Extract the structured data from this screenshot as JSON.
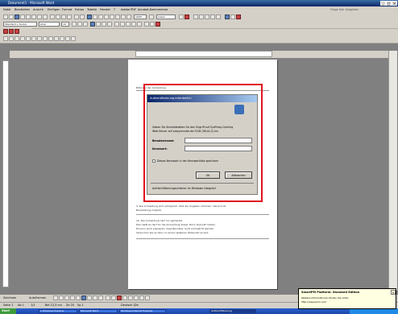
{
  "window": {
    "title": "Dokument1 - Microsoft Word"
  },
  "menu": [
    "Datei",
    "Bearbeiten",
    "Ansicht",
    "Einfügen",
    "Format",
    "Extras",
    "Tabelle",
    "Fenster",
    "?",
    "Adobe PDF",
    "Acrobat-Kommentare"
  ],
  "menu_hint": "Frage hier eingeben",
  "toolbar": {
    "style": "Standard + Kursiv",
    "font": "Arial",
    "size": "10",
    "zoom": "100%",
    "reading": "Lesen"
  },
  "page_lines": {
    "top": "Bitte bei der Anmeldung",
    "note1": "4. Die Anmeldung wird erfolgreich, falls die Angaben stimmen. Danach ist",
    "note2": "Bearbeitung möglich.",
    "p3_1": "10. Die Anmeldung darf nur gemeldet",
    "p3_2": "Das heißt es darf für die Anmeldung dieser Teil in Zukunft nutzen.",
    "p3_3": "Es kann auch passieren, dass Benutzer nicht ermöglicht werden.",
    "p3_4": "Versuchen Sie es dann zu einem späteren Zeitpunkt erneut."
  },
  "dialog": {
    "title": "Authentifizierung erforderlich",
    "message1": "Geben Sie Anmeldedaten für den Zugriff auf SysProxy-Caching",
    "message2": "Web-Server auf proxy.muster.de:3128 (96.44.2) ein",
    "username_label": "Benutzername:",
    "password_label": "Kennwort:",
    "username_value": "",
    "password_value": "",
    "remember_label": "Dieses Kennwort in der Kennwortliste speichern",
    "ok": "OK",
    "cancel": "Abbrechen",
    "footer": "Authentifizierungsschema: Im Windows integriert"
  },
  "drawbar": {
    "zeichnen": "Zeichnen",
    "autoformen": "AutoFormen"
  },
  "status": {
    "seite": "Seite 1",
    "ab": "Ab 1",
    "pages": "1/1",
    "pos": "Bei 12,5 cm",
    "ze": "Ze 20",
    "sp": "Sp 1",
    "lang": "Deutsch (De"
  },
  "taskbar": {
    "start": "Start",
    "tasks": [
      "1 Windows Explorer",
      "Microsoft Word",
      "Windows Internet Explorer",
      "Authentifizierung"
    ]
  },
  "balloon": {
    "title": "SmartPM Platform: Standard Edition",
    "line1": "Weitere Informationen finden Sie unter:",
    "line2": "http://www.pmx.com"
  },
  "colors": {
    "highlight": "#e0141e",
    "title_bar": "#0a246a",
    "taskbar": "#2a5fcf"
  }
}
